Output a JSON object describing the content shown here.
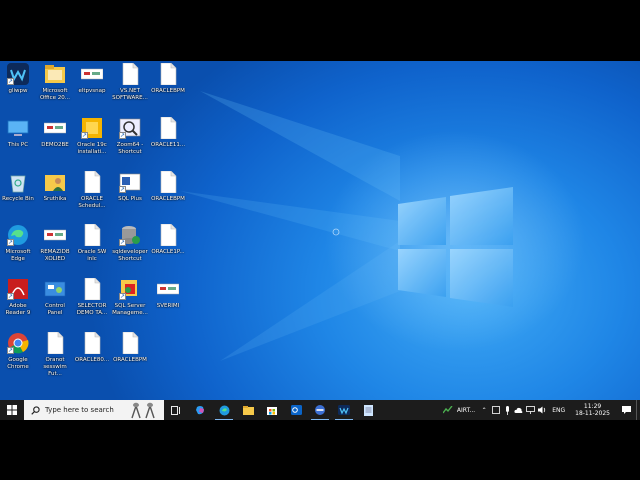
{
  "desktop": {
    "icons": [
      {
        "label": "gliwpw",
        "kind": "app-blue"
      },
      {
        "label": "Microsoft Office 20...",
        "kind": "folder"
      },
      {
        "label": "eltpvsnap",
        "kind": "ini"
      },
      {
        "label": "VS.NET SOFTWARE...",
        "kind": "doc"
      },
      {
        "label": "ORACLEBPM",
        "kind": "doc"
      },
      {
        "label": "This PC",
        "kind": "pc"
      },
      {
        "label": "DEMO2BE",
        "kind": "ini"
      },
      {
        "label": "Oracle 19c installati...",
        "kind": "oracle"
      },
      {
        "label": "Zoom64 - Shortcut",
        "kind": "zoom"
      },
      {
        "label": "ORACLE11...",
        "kind": "doc"
      },
      {
        "label": "Recycle Bin",
        "kind": "recycle"
      },
      {
        "label": "Sruthika",
        "kind": "user-folder"
      },
      {
        "label": "ORACLE Schedul...",
        "kind": "doc"
      },
      {
        "label": "SQL Plus",
        "kind": "sqlplus"
      },
      {
        "label": "ORACLEBPM",
        "kind": "doc"
      },
      {
        "label": "Microsoft Edge",
        "kind": "edge"
      },
      {
        "label": "REMAZIDB XOLIED",
        "kind": "ini"
      },
      {
        "label": "Oracle SW inlc",
        "kind": "doc"
      },
      {
        "label": "sqldeveloper Shortcut",
        "kind": "sqldev"
      },
      {
        "label": "ORACLE1P...",
        "kind": "doc"
      },
      {
        "label": "Adobe Reader 9",
        "kind": "adobe"
      },
      {
        "label": "Control Panel",
        "kind": "control"
      },
      {
        "label": "SELECTOR DEMO TA...",
        "kind": "doc"
      },
      {
        "label": "SQL Server Manageme...",
        "kind": "ssms"
      },
      {
        "label": "SVERIMI",
        "kind": "ini"
      },
      {
        "label": "Google Chrome",
        "kind": "chrome"
      },
      {
        "label": "Oranot sesswim Fut...",
        "kind": "doc"
      },
      {
        "label": "ORACLE80...",
        "kind": "doc"
      },
      {
        "label": "ORACLEBPM",
        "kind": "doc"
      }
    ]
  },
  "taskbar": {
    "search_placeholder": "Type here to search",
    "network_label": "AIRT...",
    "language": "ENG",
    "time": "11:29",
    "date": "18-11-2025"
  },
  "colors": {
    "taskbar": "#1c1c1c",
    "accent": "#0f63cc",
    "active_indicator": "#7fb8f0"
  }
}
